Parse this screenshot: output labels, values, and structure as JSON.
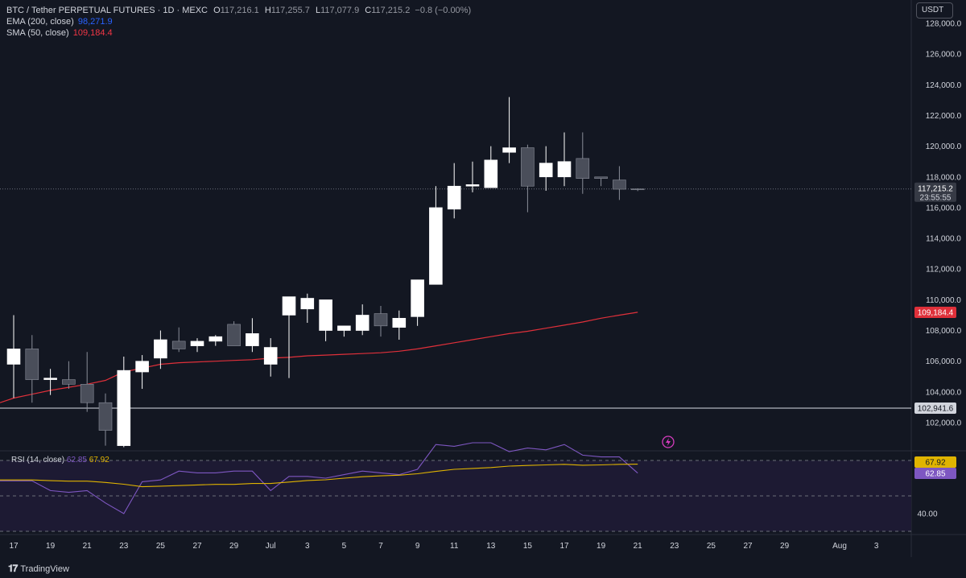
{
  "legend": {
    "symbol": "BTC / Tether PERPETUAL FUTURES · 1D · MEXC",
    "o_label": "O",
    "o_value": "117,216.1",
    "h_label": "H",
    "h_value": "117,255.7",
    "l_label": "L",
    "l_value": "117,077.9",
    "c_label": "C",
    "c_value": "117,215.2",
    "change": "−0.8 (−0.00%)",
    "ema_label": "EMA (200, close)",
    "ema_value": "98,271.9",
    "sma_label": "SMA (50, close)",
    "sma_value": "109,184.4"
  },
  "rsi_legend": {
    "label": "RSI (14, close)",
    "rsi_value": "62.85",
    "ma_value": "67.92"
  },
  "currency_button": "USDT",
  "footer": {
    "brand": "TradingView"
  },
  "price_tags": {
    "last_price": "117,215.2",
    "countdown": "23:55:55",
    "sma": "109,184.4",
    "horizontal_line": "102,941.6",
    "rsi_ma": "67.92",
    "rsi": "62.85"
  },
  "colors": {
    "background": "#131722",
    "up_candle": "#ffffff",
    "down_candle": "#4a4e5a",
    "sma": "#e0303a",
    "rsi": "#7e57c2",
    "rsi_ma": "#e0b400",
    "text": "#d1d4dc"
  },
  "chart_data": [
    {
      "type": "candlestick",
      "title": "BTC / Tether PERPETUAL FUTURES · 1D · MEXC",
      "x": [
        "Jun 17",
        "Jun 18",
        "Jun 19",
        "Jun 20",
        "Jun 21",
        "Jun 22",
        "Jun 23",
        "Jun 24",
        "Jun 25",
        "Jun 26",
        "Jun 27",
        "Jun 28",
        "Jun 29",
        "Jun 30",
        "Jul 1",
        "Jul 2",
        "Jul 3",
        "Jul 4",
        "Jul 5",
        "Jul 6",
        "Jul 7",
        "Jul 8",
        "Jul 9",
        "Jul 10",
        "Jul 11",
        "Jul 12",
        "Jul 13",
        "Jul 14",
        "Jul 15",
        "Jul 16",
        "Jul 17",
        "Jul 18",
        "Jul 19",
        "Jul 20",
        "Jul 21"
      ],
      "open": [
        105800,
        106800,
        104800,
        104800,
        104500,
        103300,
        100500,
        105300,
        106200,
        107300,
        107000,
        107300,
        108400,
        107000,
        105800,
        109000,
        109400,
        108000,
        108000,
        108000,
        109100,
        108200,
        108900,
        111000,
        115900,
        117400,
        117300,
        119600,
        119900,
        118000,
        118000,
        119200,
        118000,
        117800,
        117216.1
      ],
      "high": [
        109000,
        107700,
        105500,
        106000,
        106600,
        103900,
        106300,
        106400,
        108000,
        108200,
        107500,
        107700,
        108600,
        108800,
        107500,
        109900,
        110400,
        109800,
        108300,
        109700,
        109600,
        109300,
        111300,
        117400,
        118900,
        119000,
        120000,
        123200,
        120100,
        120000,
        120900,
        120900,
        118000,
        118700,
        117255.7
      ],
      "low": [
        103600,
        103300,
        103800,
        104200,
        102700,
        100500,
        100400,
        104200,
        105500,
        106600,
        106600,
        107000,
        107300,
        106600,
        105000,
        104900,
        108500,
        107300,
        107600,
        107700,
        107600,
        107400,
        108300,
        111000,
        115300,
        117000,
        117300,
        118900,
        115700,
        117100,
        117400,
        116900,
        117400,
        116500,
        117077.9
      ],
      "close": [
        106800,
        104800,
        104900,
        104500,
        103300,
        101500,
        105400,
        106000,
        107400,
        106800,
        107300,
        107600,
        107000,
        107800,
        106900,
        110200,
        110100,
        110000,
        108300,
        109000,
        108300,
        108800,
        111300,
        116000,
        117400,
        117500,
        119100,
        119900,
        117400,
        118900,
        119000,
        117900,
        117900,
        117200,
        117215.2
      ],
      "sma": [
        [
          0,
          103600
        ],
        [
          1,
          103850
        ],
        [
          2,
          104100
        ],
        [
          3,
          104300
        ],
        [
          4,
          104500
        ],
        [
          5,
          104750
        ],
        [
          6,
          105300
        ],
        [
          7,
          105550
        ],
        [
          8,
          105800
        ],
        [
          9,
          105900
        ],
        [
          10,
          105950
        ],
        [
          11,
          106000
        ],
        [
          12,
          106050
        ],
        [
          13,
          106100
        ],
        [
          14,
          106200
        ],
        [
          15,
          106250
        ],
        [
          16,
          106350
        ],
        [
          17,
          106400
        ],
        [
          18,
          106450
        ],
        [
          19,
          106500
        ],
        [
          20,
          106550
        ],
        [
          21,
          106650
        ],
        [
          22,
          106800
        ],
        [
          23,
          107000
        ],
        [
          24,
          107200
        ],
        [
          25,
          107400
        ],
        [
          26,
          107600
        ],
        [
          27,
          107800
        ],
        [
          28,
          107950
        ],
        [
          29,
          108150
        ],
        [
          30,
          108350
        ],
        [
          31,
          108550
        ],
        [
          32,
          108800
        ],
        [
          33,
          109000
        ],
        [
          34,
          109184.4
        ]
      ],
      "horizontal_line": 102941.6,
      "ylim": [
        100000,
        128000
      ],
      "y_ticks": [
        "102,000.0",
        "104,000.0",
        "106,000.0",
        "108,000.0",
        "110,000.0",
        "112,000.0",
        "114,000.0",
        "116,000.0",
        "118,000.0",
        "120,000.0",
        "122,000.0",
        "124,000.0",
        "126,000.0",
        "128,000.0"
      ],
      "y_tick_values": [
        102000,
        104000,
        106000,
        108000,
        110000,
        112000,
        114000,
        116000,
        118000,
        120000,
        122000,
        124000,
        126000,
        128000
      ],
      "x_tick_labels": [
        "17",
        "19",
        "21",
        "23",
        "25",
        "27",
        "29",
        "Jul",
        "3",
        "5",
        "7",
        "9",
        "11",
        "13",
        "15",
        "17",
        "19",
        "21",
        "23",
        "25",
        "27",
        "29",
        "Aug",
        "3"
      ],
      "x_tick_indices": [
        0,
        2,
        4,
        6,
        8,
        10,
        12,
        14,
        16,
        18,
        20,
        22,
        24,
        26,
        28,
        30,
        32,
        34,
        36,
        38,
        40,
        42,
        45,
        47
      ]
    },
    {
      "type": "line",
      "title": "RSI (14, close)",
      "series": [
        {
          "name": "RSI",
          "values": [
            58.5,
            58.5,
            53,
            52,
            53,
            46,
            40,
            58,
            59,
            64,
            63,
            63,
            64,
            64,
            53,
            61,
            61,
            60,
            62,
            64,
            63,
            62,
            65,
            79,
            78,
            80,
            80,
            75,
            77,
            76,
            79,
            73,
            72,
            72,
            62.85
          ]
        },
        {
          "name": "RSI MA",
          "values": [
            59,
            59,
            58.6,
            58.3,
            58.3,
            57.6,
            56.6,
            55.2,
            55.5,
            55.8,
            56.2,
            56.5,
            56.5,
            57,
            57,
            57.8,
            58.7,
            59.1,
            60,
            60.8,
            61.3,
            61.7,
            62.5,
            63.8,
            65,
            65.5,
            66,
            66.8,
            67.2,
            67.5,
            67.8,
            67.3,
            67.5,
            67.8,
            67.92
          ]
        }
      ],
      "ylim": [
        30,
        70
      ],
      "y_ticks": [
        "40.00"
      ],
      "levels": [
        70,
        50,
        30
      ]
    }
  ]
}
